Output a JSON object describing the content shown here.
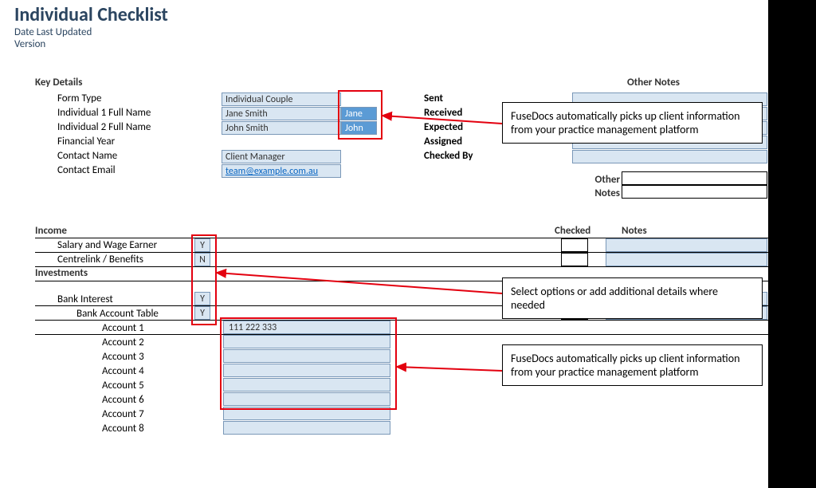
{
  "header": {
    "title": "Individual Checklist",
    "date_label": "Date Last Updated",
    "version_label": "Version"
  },
  "key_details": {
    "heading": "Key Details",
    "labels": {
      "form_type": "Form Type",
      "ind1": "Individual 1 Full Name",
      "ind2": "Individual 2 Full Name",
      "fin_year": "Financial Year",
      "contact_name": "Contact Name",
      "contact_email": "Contact Email"
    },
    "values": {
      "form_type": "Individual Couple",
      "ind1": "Jane Smith",
      "ind1_tag": "Jane",
      "ind2": "John Smith",
      "ind2_tag": "John",
      "contact_name": "Client Manager",
      "contact_email": "team@example.com.au"
    },
    "status": {
      "sent": "Sent",
      "received": "Received",
      "expected": "Expected",
      "assigned": "Assigned",
      "checked_by": "Checked By",
      "other": "Other",
      "notes": "Notes"
    },
    "other_notes_header": "Other Notes"
  },
  "sections": {
    "income_heading": "Income",
    "investments_heading": "Investments",
    "checked_header": "Checked",
    "notes_header": "Notes",
    "rows": {
      "salary": {
        "label": "Salary and Wage Earner",
        "value": "Y"
      },
      "centrelink": {
        "label": "Centrelink / Benefits",
        "value": "N"
      },
      "bank_interest": {
        "label": "Bank Interest",
        "value": "Y"
      },
      "bank_acct_table": {
        "label": "Bank Account Table",
        "value": "Y"
      }
    },
    "accounts": [
      {
        "label": "Account 1",
        "value": "111 222 333"
      },
      {
        "label": "Account 2",
        "value": ""
      },
      {
        "label": "Account 3",
        "value": ""
      },
      {
        "label": "Account 4",
        "value": ""
      },
      {
        "label": "Account 5",
        "value": ""
      },
      {
        "label": "Account 6",
        "value": ""
      },
      {
        "label": "Account 7",
        "value": ""
      },
      {
        "label": "Account 8",
        "value": ""
      }
    ]
  },
  "callouts": {
    "c1": "FuseDocs automatically picks up client information from your practice management platform",
    "c2": "Select options or add additional details where needed",
    "c3": "FuseDocs automatically picks up client information from your practice management platform"
  }
}
